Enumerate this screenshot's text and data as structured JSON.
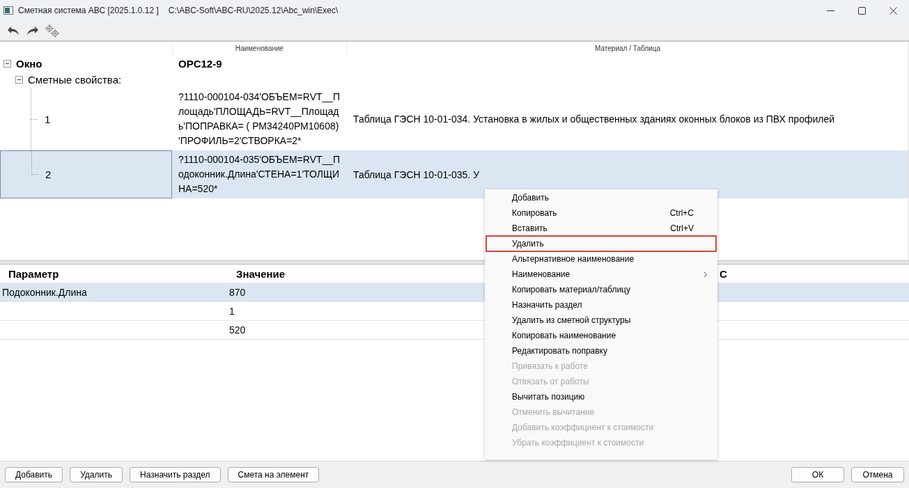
{
  "window": {
    "title": "Сметная система АВС [2025.1.0.12 ]",
    "path": "C:\\ABC-Soft\\ABC-RU\\2025.12\\Abc_win\\Exec\\"
  },
  "toolbar": [
    {
      "kind": "undo",
      "disabled": false
    },
    {
      "kind": "redo",
      "disabled": false
    },
    {
      "kind": "settings",
      "disabled": true
    }
  ],
  "tree": {
    "headers": [
      "Наименование",
      "Материал / Таблица"
    ],
    "nodes": [
      {
        "label": "Окно",
        "name": "OPC12-9",
        "expanded": true,
        "children": [
          {
            "label": "Сметные свойства:",
            "expanded": true,
            "children": [
              {
                "label": "1",
                "name": "?1110-000104-034'ОБЪЕМ=RVT__Площадь'ПЛОЩАДЬ=RVT__Площадь'ПОПРАВКА= ( РМ34240РМ10608)  'ПРОФИЛЬ=2'СТВОРКА=2*",
                "material": "Таблица ГЭСН 10-01-034. Установка в жилых и общественных зданиях оконных блоков из ПВХ профилей",
                "selected": false
              },
              {
                "label": "2",
                "name": "?1110-000104-035'ОБЪЕМ=RVT__Подоконник.Длина'СТЕНА=1'ТОЛЩИНА=520*",
                "material": "Таблица ГЭСН 10-01-035. У",
                "selected": true
              }
            ]
          }
        ]
      }
    ]
  },
  "params": {
    "headers": [
      "Параметр",
      "Значение",
      "С"
    ],
    "rows": [
      {
        "parameter": "Подоконник.Длина",
        "value": "870",
        "selected": true
      },
      {
        "value": "1",
        "selected": false
      },
      {
        "value": "520",
        "selected": false
      }
    ]
  },
  "context_menu": {
    "items": [
      {
        "label": "Добавить",
        "disabled": false,
        "highlighted": false
      },
      {
        "label": "Копировать",
        "shortcut": "Ctrl+C",
        "disabled": false,
        "highlighted": false
      },
      {
        "label": "Вставить",
        "shortcut": "Ctrl+V",
        "disabled": false,
        "highlighted": false
      },
      {
        "label": "Удалить",
        "disabled": false,
        "highlighted": true
      },
      {
        "label": "Альтернативное наименование",
        "disabled": false,
        "highlighted": false
      },
      {
        "label": "Наименование",
        "submenu": true,
        "disabled": false,
        "highlighted": false
      },
      {
        "label": "Копировать материал/таблицу",
        "disabled": false,
        "highlighted": false
      },
      {
        "label": "Назначить раздел",
        "disabled": false,
        "highlighted": false
      },
      {
        "label": "Удалить из сметной структуры",
        "disabled": false,
        "highlighted": false
      },
      {
        "label": "Копировать наименование",
        "disabled": false,
        "highlighted": false
      },
      {
        "label": "Редактировать поправку",
        "disabled": false,
        "highlighted": false
      },
      {
        "label": "Привязать к работе",
        "disabled": true,
        "highlighted": false
      },
      {
        "label": "Отвязать от работы",
        "disabled": true,
        "highlighted": false
      },
      {
        "label": "Вычитать позицию",
        "disabled": false,
        "highlighted": false
      },
      {
        "label": "Отменить вычитание",
        "disabled": true,
        "highlighted": false
      },
      {
        "label": "Добавить коэффициент к стоимости",
        "disabled": true,
        "highlighted": false
      },
      {
        "label": "Убрать коэффициент к стоимости",
        "disabled": true,
        "highlighted": false
      }
    ]
  },
  "bottom_buttons": {
    "left": [
      "Добавить",
      "Удалить",
      "Назначить раздел",
      "Смета на элемент"
    ],
    "right": [
      "ОК",
      "Отмена"
    ]
  }
}
